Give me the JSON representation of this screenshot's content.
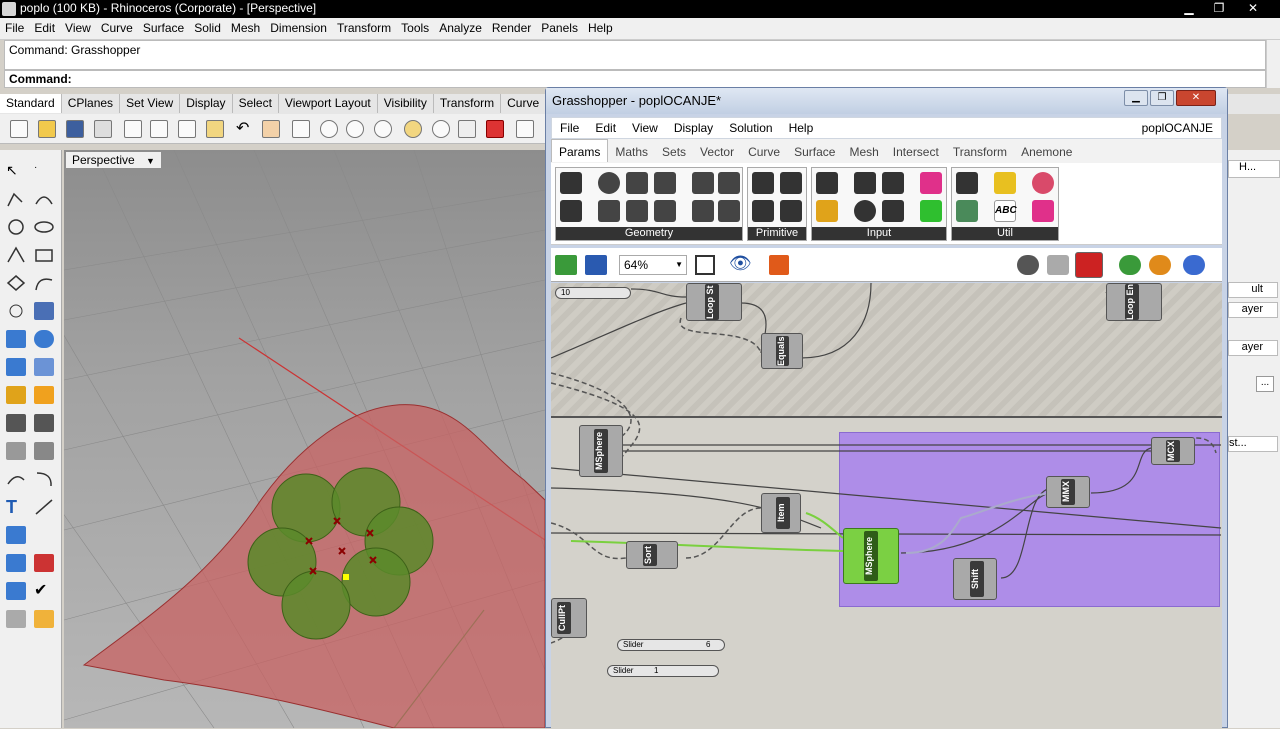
{
  "window": {
    "title": "poplo (100 KB) - Rhinoceros (Corporate) - [Perspective]",
    "min": "▁",
    "max": "❐",
    "close": "✕"
  },
  "menu": [
    "File",
    "Edit",
    "View",
    "Curve",
    "Surface",
    "Solid",
    "Mesh",
    "Dimension",
    "Transform",
    "Tools",
    "Analyze",
    "Render",
    "Panels",
    "Help"
  ],
  "command": {
    "history": "Command: Grasshopper",
    "prompt": "Command:"
  },
  "tabs": [
    "Standard",
    "CPlanes",
    "Set View",
    "Display",
    "Select",
    "Viewport Layout",
    "Visibility",
    "Transform",
    "Curve"
  ],
  "viewport": {
    "title": "Perspective"
  },
  "right_panel": {
    "tab": "H...",
    "values": [
      "ult",
      "ayer",
      "ayer",
      "...",
      "st..."
    ]
  },
  "grasshopper": {
    "title": "Grasshopper - poplOCANJE*",
    "doc_name": "poplOCANJE",
    "menu": [
      "File",
      "Edit",
      "View",
      "Display",
      "Solution",
      "Help"
    ],
    "tabs": [
      "Params",
      "Maths",
      "Sets",
      "Vector",
      "Curve",
      "Surface",
      "Mesh",
      "Intersect",
      "Transform",
      "Anemone"
    ],
    "active_tab": "Params",
    "groups": [
      "Geometry",
      "Primitive",
      "Input",
      "Util"
    ],
    "zoom": "64%",
    "components": {
      "loop_start": "Loop St",
      "equals": "Equals",
      "loop_end": "Loop En",
      "msphere1": "MSphere",
      "item": "Item",
      "sort": "Sort",
      "msphere2": "MSphere",
      "shift": "Shift",
      "mmx": "MMX",
      "mcx": "MCX",
      "cullpt": "CullPt"
    },
    "sliders": {
      "top": "10",
      "slider1_label": "Slider",
      "slider1_value": "6",
      "slider2_label": "Slider",
      "slider2_value": "1"
    }
  },
  "colors": {
    "surface": "#c86161",
    "sphere": "#5a8a2a",
    "group": "#a276f2",
    "selected_component": "#7bd043"
  }
}
